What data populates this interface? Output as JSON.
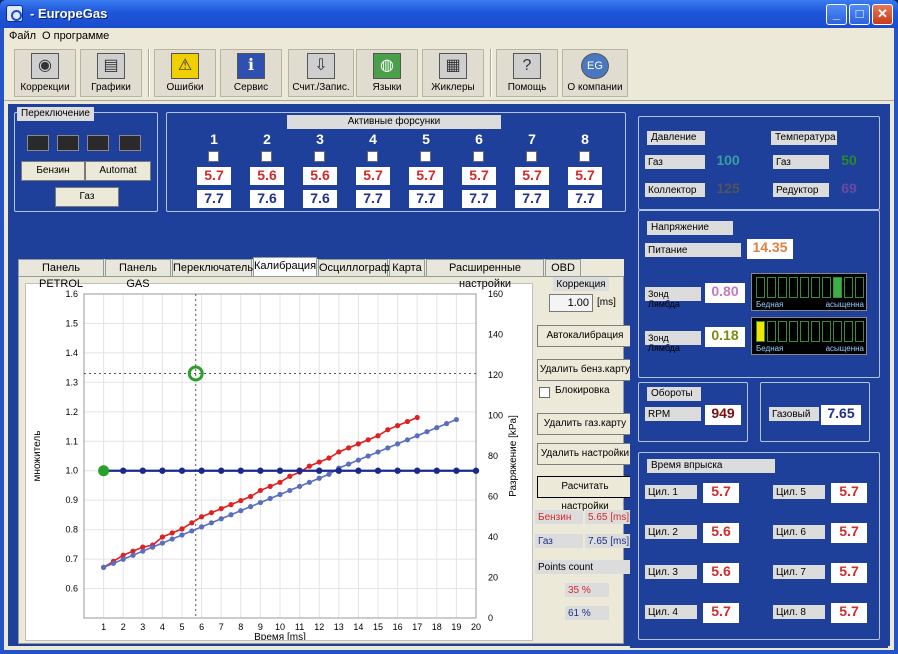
{
  "window": {
    "title": "- EuropeGas",
    "min_label": "_",
    "max_label": "□",
    "close_label": "✕"
  },
  "menu": {
    "file": "Файл",
    "about": "О программе"
  },
  "toolbar": [
    {
      "label": "Коррекции",
      "icon": "correction-icon",
      "glyph": "◉"
    },
    {
      "label": "Графики",
      "icon": "chart-icon",
      "glyph": "▤"
    },
    {
      "label": "Ошибки",
      "icon": "warning-icon",
      "glyph": "⚠"
    },
    {
      "label": "Сервис",
      "icon": "info-icon",
      "glyph": "ℹ"
    },
    {
      "label": "Счит./Запис.",
      "icon": "download-icon",
      "glyph": "⇩"
    },
    {
      "label": "Языки",
      "icon": "globe-icon",
      "glyph": "◍"
    },
    {
      "label": "Жиклеры",
      "icon": "injector-icon",
      "glyph": "▦"
    },
    {
      "label": "Помощь",
      "icon": "help-icon",
      "glyph": "?"
    },
    {
      "label": "О компании",
      "icon": "company-logo-icon",
      "glyph": "EG"
    }
  ],
  "switching": {
    "title": "Переключение",
    "petrol_btn": "Бензин",
    "auto_btn": "Automat",
    "gas_btn": "Газ"
  },
  "injectors": {
    "title": "Активные форсунки",
    "numbers": [
      "1",
      "2",
      "3",
      "4",
      "5",
      "6",
      "7",
      "8"
    ],
    "petrol": [
      "5.7",
      "5.6",
      "5.6",
      "5.7",
      "5.7",
      "5.7",
      "5.7",
      "5.7"
    ],
    "gas": [
      "7.7",
      "7.6",
      "7.6",
      "7.7",
      "7.7",
      "7.7",
      "7.7",
      "7.7"
    ]
  },
  "tabs": [
    "Панель PETROL",
    "Панель GAS",
    "Переключатель",
    "Калибрация",
    "Осциллограф",
    "Карта",
    "Расширенные настройки",
    "OBD"
  ],
  "active_tab": 3,
  "calibration": {
    "correction_label": "Коррекция",
    "correction_value": "1.00",
    "correction_unit": "[ms]",
    "autocal_btn": "Автокалибрация",
    "del_petrol_btn": "Удалить бенз.карту",
    "lock_label": "Блокировка",
    "del_gas_btn": "Удалить газ.карту",
    "del_settings_btn": "Удалить настройки",
    "calc_btn": "Расчитать настройки",
    "petrol_label": "Бензин",
    "petrol_value": "5.65 [ms]",
    "gas_label": "Газ",
    "gas_value": "7.65 [ms]",
    "points_label": "Points count",
    "pct1": "35 %",
    "pct2": "61 %"
  },
  "chart_data": {
    "type": "line",
    "xlabel": "Время [ms]",
    "ylabel": "множитель",
    "y2label": "Разряжение [kPa]",
    "xlim": [
      0,
      20
    ],
    "ylim": [
      0.5,
      1.6
    ],
    "y2lim": [
      0,
      160
    ],
    "x_ticks": [
      1,
      2,
      3,
      4,
      5,
      6,
      7,
      8,
      9,
      10,
      11,
      12,
      13,
      14,
      15,
      16,
      17,
      18,
      19,
      20
    ],
    "y_ticks": [
      "0.6",
      "0.7",
      "0.8",
      "0.9",
      "1.0",
      "1.1",
      "1.2",
      "1.3",
      "1.4",
      "1.5",
      "1.6"
    ],
    "y2_ticks": [
      "0",
      "20",
      "40",
      "60",
      "80",
      "100",
      "120",
      "140",
      "160"
    ],
    "grid": true,
    "series": [
      {
        "color": "#e02020",
        "axis": "y2",
        "x": [
          1,
          1.5,
          2,
          2.5,
          3,
          3.5,
          4,
          4.5,
          5,
          5.5,
          6,
          6.5,
          7,
          7.5,
          8,
          8.5,
          9,
          9.5,
          10,
          10.5,
          11,
          11.5,
          12,
          12.5,
          13,
          13.5,
          14,
          14.5,
          15,
          15.5,
          16,
          16.5,
          17
        ],
        "values": [
          25,
          28,
          31,
          33,
          35,
          36,
          40,
          42,
          44,
          47,
          50,
          52,
          54,
          56,
          58,
          60,
          63,
          65,
          67,
          70,
          72,
          75,
          77,
          79,
          82,
          84,
          86,
          88,
          90,
          93,
          95,
          97,
          99
        ]
      },
      {
        "color": "#5a6ec0",
        "axis": "y2",
        "x": [
          1,
          1.5,
          2,
          2.5,
          3,
          3.5,
          4,
          4.5,
          5,
          5.5,
          6,
          6.5,
          7,
          7.5,
          8,
          8.5,
          9,
          9.5,
          10,
          10.5,
          11,
          11.5,
          12,
          12.5,
          13,
          13.5,
          14,
          14.5,
          15,
          15.5,
          16,
          16.5,
          17,
          17.5,
          18,
          18.5,
          19
        ],
        "values": [
          25,
          27,
          29,
          31,
          33,
          35,
          37,
          39,
          41,
          43,
          45,
          47,
          49,
          51,
          53,
          55,
          57,
          59,
          61,
          63,
          65,
          67,
          69,
          71,
          74,
          76,
          78,
          80,
          82,
          84,
          86,
          88,
          90,
          92,
          94,
          96,
          98
        ]
      },
      {
        "color": "#1a2a8a",
        "axis": "y",
        "x": [
          1,
          2,
          3,
          4,
          5,
          6,
          7,
          8,
          9,
          10,
          11,
          12,
          13,
          14,
          15,
          16,
          17,
          18,
          19,
          20
        ],
        "values": [
          1,
          1,
          1,
          1,
          1,
          1,
          1,
          1,
          1,
          1,
          1,
          1,
          1,
          1,
          1,
          1,
          1,
          1,
          1,
          1
        ]
      }
    ],
    "cursor_x": 5.7,
    "cursor_y": 1.33
  },
  "pressure": {
    "title": "Давление",
    "gas_label": "Газ",
    "gas_value": "100",
    "coll_label": "Коллектор",
    "coll_value": "125"
  },
  "temperature": {
    "title": "Температура",
    "gas_label": "Газ",
    "gas_value": "50",
    "red_label": "Редуктор",
    "red_value": "69"
  },
  "voltage": {
    "title": "Напряжение",
    "supply_label": "Питание",
    "supply_value": "14.35",
    "lambda1_label": "Зонд Лямбда",
    "lambda1_value": "0.80",
    "lambda2_label": "Зонд Лямбда",
    "lambda2_value": "0.18",
    "lean": "Бедная",
    "rich": "асыщенна"
  },
  "rpm": {
    "title": "Обороты",
    "label": "RPM",
    "value": "949"
  },
  "gas_rpm": {
    "label": "Газовый",
    "value": "7.65"
  },
  "inj_time": {
    "title": "Время впрыска",
    "cyls": [
      {
        "label": "Цил. 1",
        "value": "5.7"
      },
      {
        "label": "Цил. 2",
        "value": "5.6"
      },
      {
        "label": "Цил. 3",
        "value": "5.6"
      },
      {
        "label": "Цил. 4",
        "value": "5.7"
      },
      {
        "label": "Цил. 5",
        "value": "5.7"
      },
      {
        "label": "Цил. 6",
        "value": "5.7"
      },
      {
        "label": "Цил. 7",
        "value": "5.7"
      },
      {
        "label": "Цил. 8",
        "value": "5.7"
      }
    ]
  },
  "colors": {
    "petrol": "#d42a2a",
    "gas": "#1f2f8a",
    "lambda_on": "#3cb043",
    "lambda_yellow": "#f2e600"
  }
}
